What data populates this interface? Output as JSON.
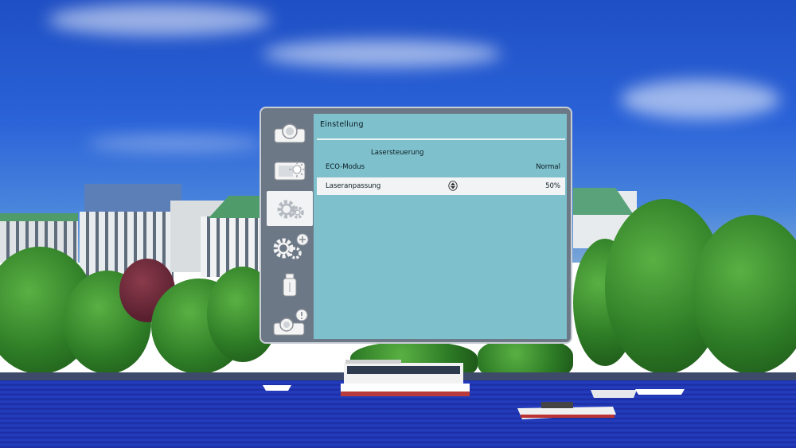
{
  "osd": {
    "title": "Einstellung",
    "section": "Lasersteuerung",
    "rows": [
      {
        "label": "ECO-Modus",
        "value": "Normal"
      },
      {
        "label": "Laseranpassung",
        "value": "50%"
      }
    ],
    "nav": [
      {
        "name": "image-settings-icon"
      },
      {
        "name": "brightness-adjust-icon"
      },
      {
        "name": "settings-gear-icon"
      },
      {
        "name": "extended-settings-gear-icon"
      },
      {
        "name": "usb-memory-icon"
      },
      {
        "name": "information-icon"
      }
    ],
    "active_index": 2
  },
  "colors": {
    "panel": "#7ec1cc",
    "highlight": "#f1f3f5",
    "frame": "#6d7886"
  }
}
